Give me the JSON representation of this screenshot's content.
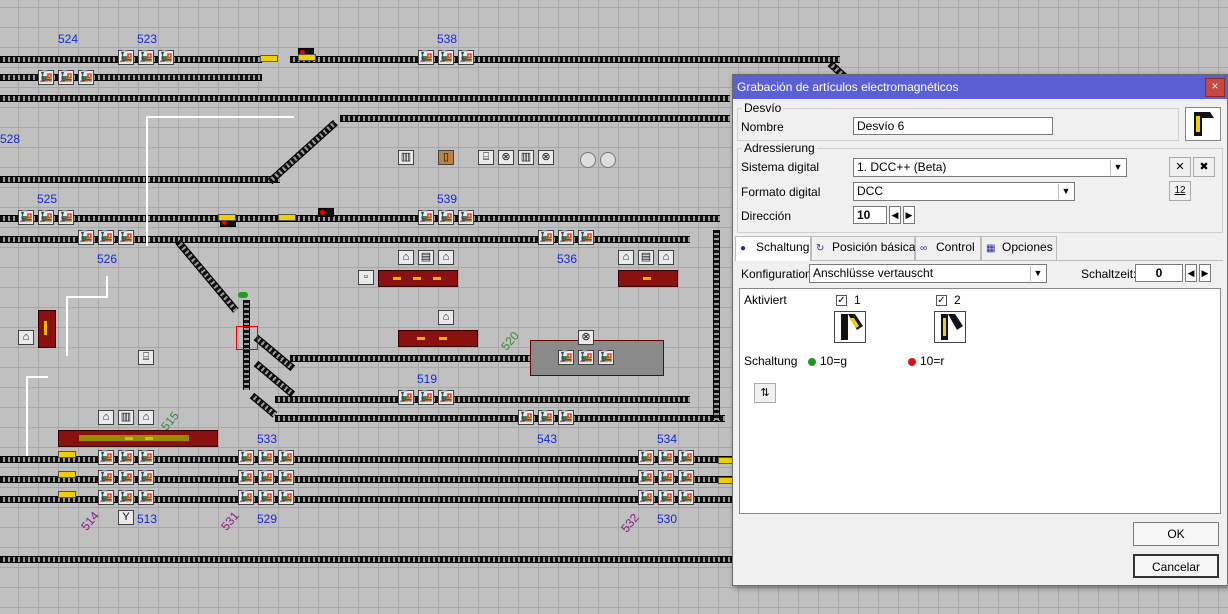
{
  "layout": {
    "labels_blue": [
      "524",
      "523",
      "538",
      "528",
      "525",
      "539",
      "526",
      "536",
      "519",
      "543",
      "533",
      "534",
      "513",
      "529",
      "530"
    ],
    "labels_purple": [
      "514",
      "531",
      "532"
    ],
    "labels_green": [
      "515",
      "520"
    ]
  },
  "dialog": {
    "title": "Grabación de artículos electromagnéticos",
    "close_glyph": "×",
    "group_desvio": "Desvío",
    "nombre_label": "Nombre",
    "nombre_value": "Desvío 6",
    "group_adressierung": "Adressierung",
    "sistema_label": "Sistema digital",
    "sistema_value": "1. DCC++ (Beta)",
    "formato_label": "Formato digital",
    "formato_value": "DCC",
    "direccion_label": "Dirección",
    "direccion_value": "10",
    "addr_icon_text": "12",
    "tabs": [
      {
        "label": "Schaltung",
        "icon": "switch-state-icon"
      },
      {
        "label": "Posición básica",
        "icon": "basic-position-icon"
      },
      {
        "label": "Control",
        "icon": "binoculars-icon"
      },
      {
        "label": "Opciones",
        "icon": "options-icon"
      }
    ],
    "konfig_label": "Konfiguration:",
    "konfig_value": "Anschlüsse vertauscht",
    "schaltzeit_label": "Schaltzeit:",
    "schaltzeit_value": "0",
    "aktiviert_label": "Aktiviert",
    "cb1_label": "1",
    "cb2_label": "2",
    "cb1_checked": true,
    "cb2_checked": true,
    "schaltung_label": "Schaltung",
    "state1": "10=g",
    "state2": "10=r",
    "state1_color": "#1a9a1a",
    "state2_color": "#e01010",
    "ok_label": "OK",
    "cancel_label": "Cancelar",
    "check_glyph": "✓"
  }
}
